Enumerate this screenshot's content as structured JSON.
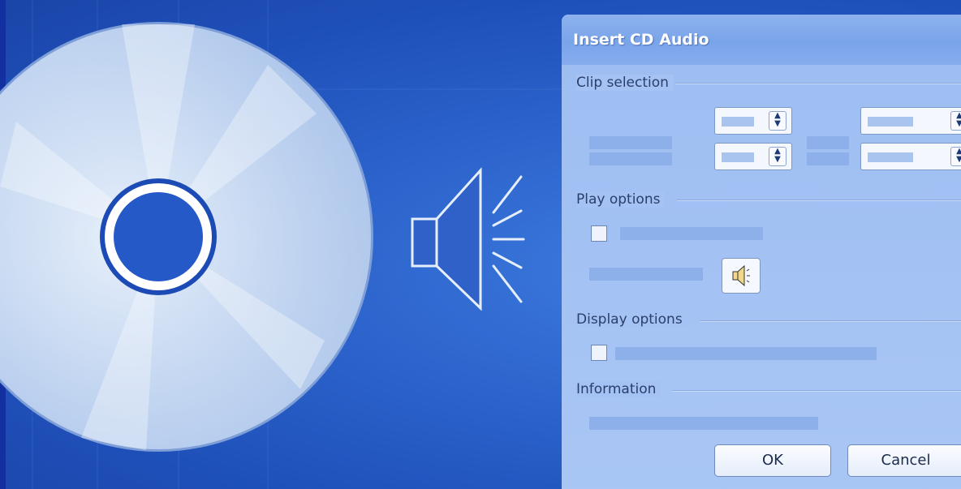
{
  "dialog": {
    "title": "Insert CD Audio",
    "groups": {
      "clip_selection": "Clip selection",
      "play_options": "Play options",
      "display_options": "Display options",
      "information": "Information"
    },
    "buttons": {
      "ok": "OK",
      "cancel": "Cancel"
    },
    "checkboxes": {
      "play_option_checked": false,
      "display_option_checked": false
    }
  },
  "icons": [
    "cd-disc-icon",
    "speaker-icon",
    "spin-up-down-icon",
    "volume-icon",
    "checkbox-icon"
  ],
  "colors": {
    "background": "#2c63cc",
    "dialog": "#a4c2f3",
    "title_bar": "#7aa4ea",
    "placeholder": "#8eb0ea"
  }
}
